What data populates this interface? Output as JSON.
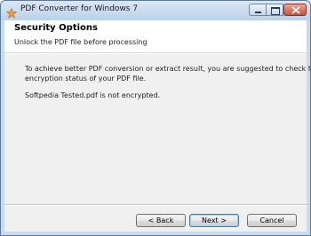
{
  "window": {
    "title": "PDF Converter for Windows 7"
  },
  "header": {
    "title": "Security Options",
    "subtitle": "Unlock the PDF file before processing"
  },
  "content": {
    "paragraph1_line1": "To achieve better PDF conversion or extract result, you are suggested to check the",
    "paragraph1_line2": "encryption status of your PDF file.",
    "paragraph2": "Softpedia Tested.pdf is not encrypted."
  },
  "buttons": {
    "back": "< Back",
    "next": "Next >",
    "cancel": "Cancel"
  },
  "colors": {
    "titlebar": "#bcd1ea",
    "close_button": "#c5503c",
    "dialog_background": "#f0f0f0"
  }
}
